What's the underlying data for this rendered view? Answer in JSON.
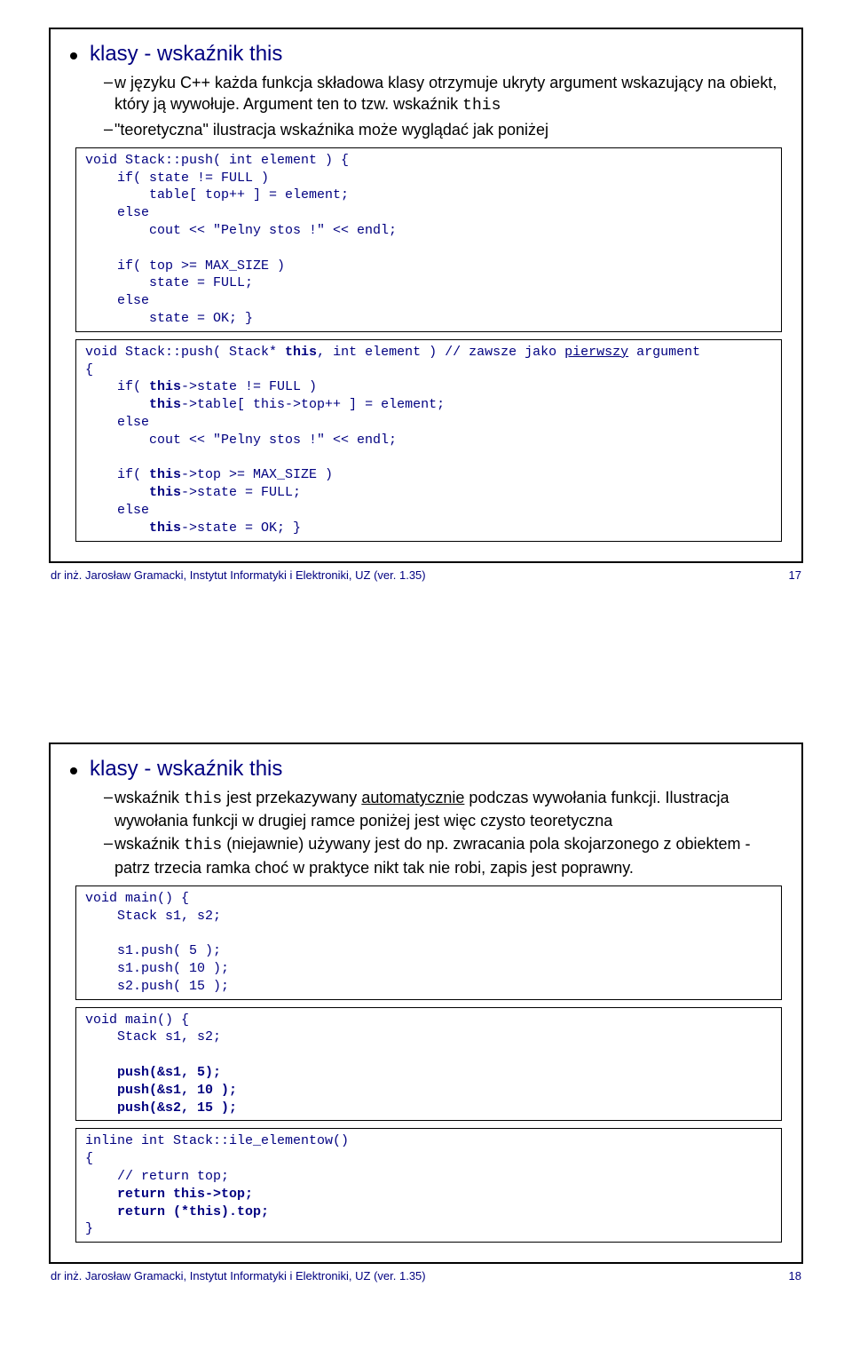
{
  "slide1": {
    "title": "klasy - wskaźnik this",
    "sub1": "w języku C++ każda funkcja składowa klasy otrzymuje ukryty argument wskazujący na obiekt, który ją wywołuje. Argument ten to tzw. wskaźnik ",
    "sub1_code": "this",
    "sub2": "\"teoretyczna\" ilustracja wskaźnika może wyglądać jak poniżej",
    "code1": "void Stack::push( int element ) {\n    if( state != FULL )\n        table[ top++ ] = element;\n    else\n        cout << \"Pelny stos !\" << endl;\n\n    if( top >= MAX_SIZE )\n        state = FULL;\n    else\n        state = OK; }",
    "code2_a": "void Stack::push( Stack* ",
    "code2_b": "this",
    "code2_c": ", int element ) // zawsze jako ",
    "code2_d": "pierwszy",
    "code2_e": " argument\n{\n    if( ",
    "code2_f": "this",
    "code2_g": "->state != FULL )\n        ",
    "code2_h": "this",
    "code2_i": "->table[ this->top++ ] = element;\n    else\n        cout << \"Pelny stos !\" << endl;\n\n    if( ",
    "code2_j": "this",
    "code2_k": "->top >= MAX_SIZE )\n        ",
    "code2_l": "this",
    "code2_m": "->state = FULL;\n    else\n        ",
    "code2_n": "this",
    "code2_o": "->state = OK; }"
  },
  "slide2": {
    "title": "klasy - wskaźnik this",
    "sub1_a": "wskaźnik ",
    "sub1_code": "this",
    "sub1_b": " jest przekazywany ",
    "sub1_u": "automatycznie",
    "sub1_c": " podczas wywołania funkcji. Ilustracja wywołania funkcji w drugiej ramce poniżej jest więc czysto teoretyczna",
    "sub2_a": "wskaźnik ",
    "sub2_code": "this",
    "sub2_b": "  (niejawnie) używany jest do np. zwracania pola skojarzonego z obiektem - patrz trzecia ramka choć w praktyce nikt tak nie robi, zapis jest poprawny.",
    "code1": "void main() {\n    Stack s1, s2;\n\n    s1.push( 5 );\n    s1.push( 10 );\n    s2.push( 15 );",
    "code2_a": "void main() {\n    Stack s1, s2;\n\n    ",
    "code2_b": "push(&s1, 5);\n    push(&s1, 10 );\n    push(&s2, 15 );",
    "code3_a": "inline int Stack::ile_elementow()\n{\n    // return top;\n    ",
    "code3_b": "return this->top;",
    "code3_c": "\n    ",
    "code3_d": "return (*this).top;",
    "code3_e": "\n}"
  },
  "footer": {
    "text": "dr inż. Jarosław Gramacki, Instytut Informatyki i Elektroniki, UZ (ver. 1.35)",
    "page1": "17",
    "page2": "18"
  }
}
